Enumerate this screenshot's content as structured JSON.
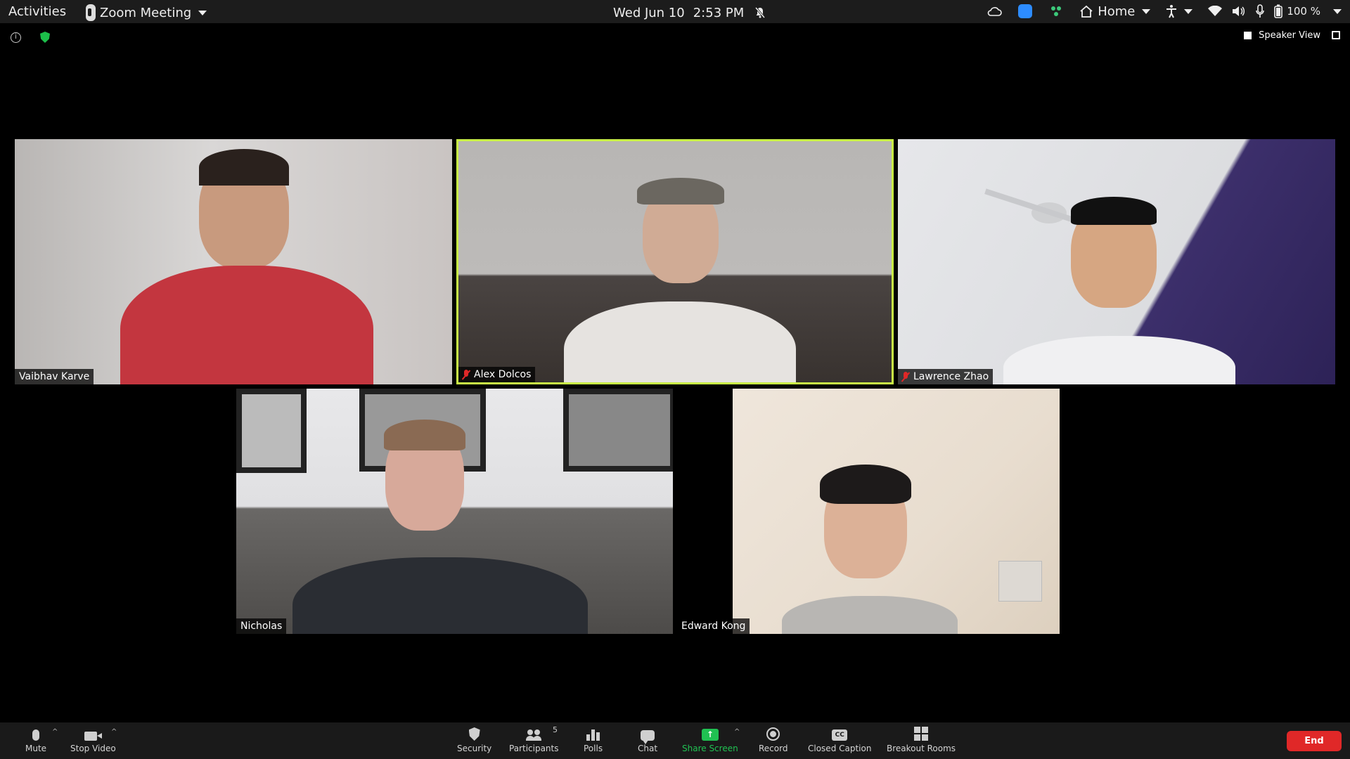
{
  "topbar": {
    "activities": "Activities",
    "app_name": "Zoom Meeting",
    "date": "Wed Jun 10",
    "time": "2:53 PM",
    "home_label": "Home",
    "battery": "100 %"
  },
  "meeting_header": {
    "view_label": "Speaker View"
  },
  "participants": [
    {
      "name": "Vaibhav Karve",
      "muted": false,
      "active_speaker": false
    },
    {
      "name": "Alex Dolcos",
      "muted": true,
      "active_speaker": true
    },
    {
      "name": "Lawrence Zhao",
      "muted": true,
      "active_speaker": false
    },
    {
      "name": "Nicholas",
      "muted": false,
      "active_speaker": false
    },
    {
      "name": "Edward Kong",
      "muted": false,
      "active_speaker": false
    }
  ],
  "toolbar": {
    "mute": "Mute",
    "stop_video": "Stop Video",
    "security": "Security",
    "participants": "Participants",
    "participants_count": "5",
    "polls": "Polls",
    "chat": "Chat",
    "share_screen": "Share Screen",
    "record": "Record",
    "closed_caption": "Closed Caption",
    "cc_glyph": "CC",
    "breakout_rooms": "Breakout Rooms",
    "end": "End"
  },
  "colors": {
    "active_speaker_border": "#c9f046",
    "share_green": "#20c152",
    "end_red": "#e02828",
    "muted_red": "#e02828",
    "security_green": "#1cbf4a"
  },
  "icons": {
    "topbar": [
      "cloud-icon",
      "zoom-icon",
      "puzzle-icon",
      "home-icon",
      "accessibility-icon",
      "wifi-icon",
      "volume-icon",
      "microphone-icon",
      "battery-icon",
      "notifications-off-icon"
    ],
    "meeting": [
      "info-icon",
      "security-shield-icon",
      "speaker-view-icon",
      "fullscreen-icon"
    ]
  }
}
